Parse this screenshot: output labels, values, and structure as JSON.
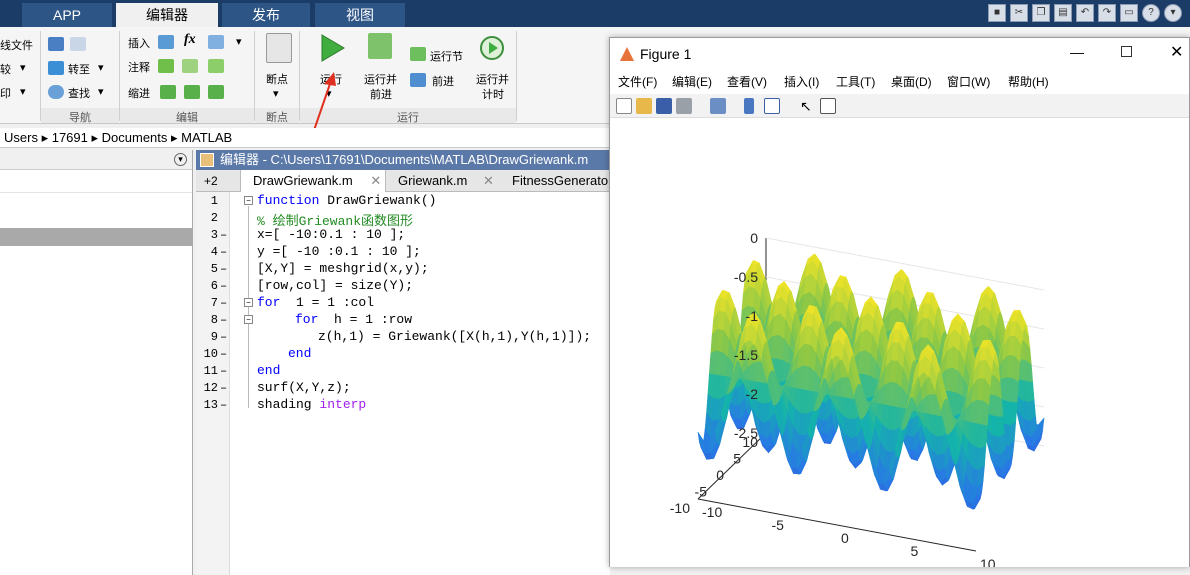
{
  "tabs": [
    {
      "label": "APP",
      "active": false
    },
    {
      "label": "编辑器",
      "active": true
    },
    {
      "label": "发布",
      "active": false
    },
    {
      "label": "视图",
      "active": false
    }
  ],
  "ribbon": {
    "file_group": [
      "线文件",
      "较",
      "印"
    ],
    "nav": {
      "goto": "转至",
      "find": "查找",
      "section": "导航"
    },
    "edit": {
      "insert": "插入",
      "comment": "注释",
      "indent": "缩进",
      "fx": "fx",
      "section": "编辑"
    },
    "breakpoints": {
      "label": "断点",
      "section": "断点"
    },
    "run": {
      "run": "运行",
      "run_advance": [
        "运行并",
        "前进"
      ],
      "run_section": "运行节",
      "advance": "前进",
      "run_time": [
        "运行并",
        "计时"
      ],
      "section": "运行"
    }
  },
  "address": [
    "Users",
    "17691",
    "Documents",
    "MATLAB"
  ],
  "editor": {
    "title": "编辑器 - C:\\Users\\17691\\Documents\\MATLAB\\DrawGriewank.m",
    "tab_count": "+2",
    "tabs": [
      "DrawGriewank.m",
      "Griewank.m",
      "FitnessGenerato"
    ],
    "line_numbers": [
      "1",
      "2",
      "3",
      "4",
      "5",
      "6",
      "7",
      "8",
      "9",
      "10",
      "11",
      "12",
      "13"
    ],
    "code": {
      "l1_kw": "function",
      "l1": " DrawGriewank()",
      "l2": "% 绘制Griewank函数图形",
      "l3": "x=[ -10:0.1 : 10 ];",
      "l4": "y =[ -10 :0.1 : 10 ];",
      "l5": "[X,Y] = meshgrid(x,y);",
      "l6": "[row,col] = size(Y);",
      "l7_kw": "for",
      "l7": "  1 = 1 :col",
      "l8_kw": "for",
      "l8": "  h = 1 :row",
      "l9": "z(h,1) = Griewank([X(h,1),Y(h,1)]);",
      "l10": "end",
      "l11": "end",
      "l12": "surf(X,Y,z);",
      "l13": "shading ",
      "l13_st": "interp"
    }
  },
  "figure": {
    "title": "Figure 1",
    "menu": [
      "文件(F)",
      "编辑(E)",
      "查看(V)",
      "插入(I)",
      "工具(T)",
      "桌面(D)",
      "窗口(W)",
      "帮助(H)"
    ]
  },
  "chart_data": {
    "type": "surface",
    "description_source": "surf of Griewank function, shading interp, parula colormap",
    "zlim": [
      -2.5,
      0
    ],
    "z_ticks": [
      "0",
      "-0.5",
      "-1",
      "-1.5",
      "-2",
      "-2.5"
    ],
    "y_ticks": [
      "10",
      "5",
      "0",
      "-5",
      "-10"
    ],
    "x_ticks": [
      "-10",
      "-5",
      "0",
      "5",
      "10"
    ],
    "colors": {
      "low": "#3b2fb0",
      "mid": "#1fb3a8",
      "high": "#f9e625"
    }
  }
}
